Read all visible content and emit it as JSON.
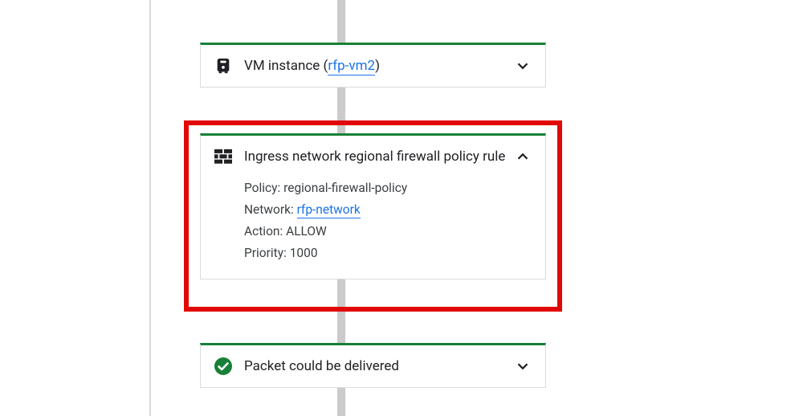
{
  "timeline": {
    "vmCard": {
      "titlePrefix": "VM instance",
      "linkText": "rfp-vm2",
      "expanded": false
    },
    "firewallCard": {
      "title": "Ingress network regional firewall policy rule",
      "expanded": true,
      "details": {
        "policyLabel": "Policy:",
        "policyValue": "regional-firewall-policy",
        "networkLabel": "Network:",
        "networkLink": "rfp-network",
        "actionLabel": "Action:",
        "actionValue": "ALLOW",
        "priorityLabel": "Priority:",
        "priorityValue": "1000"
      }
    },
    "deliveryCard": {
      "title": "Packet could be delivered",
      "expanded": false
    }
  },
  "icons": {
    "vm": "vm-instance-icon",
    "firewall": "firewall-icon",
    "success": "check-circle-icon",
    "chevDown": "chevron-down-icon",
    "chevUp": "chevron-up-icon"
  },
  "colors": {
    "accent": "#188038",
    "link": "#1a73e8",
    "highlight": "#e20808"
  }
}
